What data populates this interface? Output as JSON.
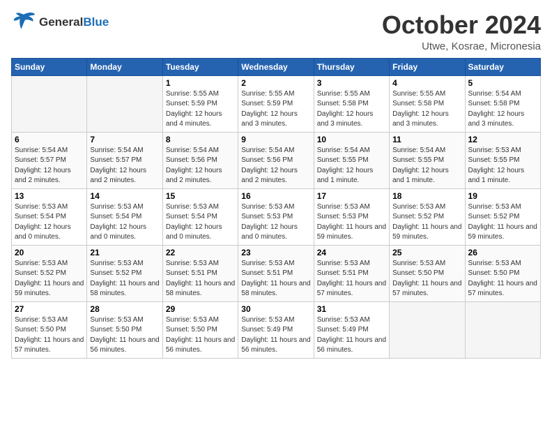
{
  "logo": {
    "line1": "General",
    "line2": "Blue"
  },
  "title": "October 2024",
  "location": "Utwe, Kosrae, Micronesia",
  "weekdays": [
    "Sunday",
    "Monday",
    "Tuesday",
    "Wednesday",
    "Thursday",
    "Friday",
    "Saturday"
  ],
  "weeks": [
    [
      {
        "day": "",
        "empty": true
      },
      {
        "day": "",
        "empty": true
      },
      {
        "day": "1",
        "sunrise": "Sunrise: 5:55 AM",
        "sunset": "Sunset: 5:59 PM",
        "daylight": "Daylight: 12 hours and 4 minutes."
      },
      {
        "day": "2",
        "sunrise": "Sunrise: 5:55 AM",
        "sunset": "Sunset: 5:59 PM",
        "daylight": "Daylight: 12 hours and 3 minutes."
      },
      {
        "day": "3",
        "sunrise": "Sunrise: 5:55 AM",
        "sunset": "Sunset: 5:58 PM",
        "daylight": "Daylight: 12 hours and 3 minutes."
      },
      {
        "day": "4",
        "sunrise": "Sunrise: 5:55 AM",
        "sunset": "Sunset: 5:58 PM",
        "daylight": "Daylight: 12 hours and 3 minutes."
      },
      {
        "day": "5",
        "sunrise": "Sunrise: 5:54 AM",
        "sunset": "Sunset: 5:58 PM",
        "daylight": "Daylight: 12 hours and 3 minutes."
      }
    ],
    [
      {
        "day": "6",
        "sunrise": "Sunrise: 5:54 AM",
        "sunset": "Sunset: 5:57 PM",
        "daylight": "Daylight: 12 hours and 2 minutes."
      },
      {
        "day": "7",
        "sunrise": "Sunrise: 5:54 AM",
        "sunset": "Sunset: 5:57 PM",
        "daylight": "Daylight: 12 hours and 2 minutes."
      },
      {
        "day": "8",
        "sunrise": "Sunrise: 5:54 AM",
        "sunset": "Sunset: 5:56 PM",
        "daylight": "Daylight: 12 hours and 2 minutes."
      },
      {
        "day": "9",
        "sunrise": "Sunrise: 5:54 AM",
        "sunset": "Sunset: 5:56 PM",
        "daylight": "Daylight: 12 hours and 2 minutes."
      },
      {
        "day": "10",
        "sunrise": "Sunrise: 5:54 AM",
        "sunset": "Sunset: 5:55 PM",
        "daylight": "Daylight: 12 hours and 1 minute."
      },
      {
        "day": "11",
        "sunrise": "Sunrise: 5:54 AM",
        "sunset": "Sunset: 5:55 PM",
        "daylight": "Daylight: 12 hours and 1 minute."
      },
      {
        "day": "12",
        "sunrise": "Sunrise: 5:53 AM",
        "sunset": "Sunset: 5:55 PM",
        "daylight": "Daylight: 12 hours and 1 minute."
      }
    ],
    [
      {
        "day": "13",
        "sunrise": "Sunrise: 5:53 AM",
        "sunset": "Sunset: 5:54 PM",
        "daylight": "Daylight: 12 hours and 0 minutes."
      },
      {
        "day": "14",
        "sunrise": "Sunrise: 5:53 AM",
        "sunset": "Sunset: 5:54 PM",
        "daylight": "Daylight: 12 hours and 0 minutes."
      },
      {
        "day": "15",
        "sunrise": "Sunrise: 5:53 AM",
        "sunset": "Sunset: 5:54 PM",
        "daylight": "Daylight: 12 hours and 0 minutes."
      },
      {
        "day": "16",
        "sunrise": "Sunrise: 5:53 AM",
        "sunset": "Sunset: 5:53 PM",
        "daylight": "Daylight: 12 hours and 0 minutes."
      },
      {
        "day": "17",
        "sunrise": "Sunrise: 5:53 AM",
        "sunset": "Sunset: 5:53 PM",
        "daylight": "Daylight: 11 hours and 59 minutes."
      },
      {
        "day": "18",
        "sunrise": "Sunrise: 5:53 AM",
        "sunset": "Sunset: 5:52 PM",
        "daylight": "Daylight: 11 hours and 59 minutes."
      },
      {
        "day": "19",
        "sunrise": "Sunrise: 5:53 AM",
        "sunset": "Sunset: 5:52 PM",
        "daylight": "Daylight: 11 hours and 59 minutes."
      }
    ],
    [
      {
        "day": "20",
        "sunrise": "Sunrise: 5:53 AM",
        "sunset": "Sunset: 5:52 PM",
        "daylight": "Daylight: 11 hours and 59 minutes."
      },
      {
        "day": "21",
        "sunrise": "Sunrise: 5:53 AM",
        "sunset": "Sunset: 5:52 PM",
        "daylight": "Daylight: 11 hours and 58 minutes."
      },
      {
        "day": "22",
        "sunrise": "Sunrise: 5:53 AM",
        "sunset": "Sunset: 5:51 PM",
        "daylight": "Daylight: 11 hours and 58 minutes."
      },
      {
        "day": "23",
        "sunrise": "Sunrise: 5:53 AM",
        "sunset": "Sunset: 5:51 PM",
        "daylight": "Daylight: 11 hours and 58 minutes."
      },
      {
        "day": "24",
        "sunrise": "Sunrise: 5:53 AM",
        "sunset": "Sunset: 5:51 PM",
        "daylight": "Daylight: 11 hours and 57 minutes."
      },
      {
        "day": "25",
        "sunrise": "Sunrise: 5:53 AM",
        "sunset": "Sunset: 5:50 PM",
        "daylight": "Daylight: 11 hours and 57 minutes."
      },
      {
        "day": "26",
        "sunrise": "Sunrise: 5:53 AM",
        "sunset": "Sunset: 5:50 PM",
        "daylight": "Daylight: 11 hours and 57 minutes."
      }
    ],
    [
      {
        "day": "27",
        "sunrise": "Sunrise: 5:53 AM",
        "sunset": "Sunset: 5:50 PM",
        "daylight": "Daylight: 11 hours and 57 minutes."
      },
      {
        "day": "28",
        "sunrise": "Sunrise: 5:53 AM",
        "sunset": "Sunset: 5:50 PM",
        "daylight": "Daylight: 11 hours and 56 minutes."
      },
      {
        "day": "29",
        "sunrise": "Sunrise: 5:53 AM",
        "sunset": "Sunset: 5:50 PM",
        "daylight": "Daylight: 11 hours and 56 minutes."
      },
      {
        "day": "30",
        "sunrise": "Sunrise: 5:53 AM",
        "sunset": "Sunset: 5:49 PM",
        "daylight": "Daylight: 11 hours and 56 minutes."
      },
      {
        "day": "31",
        "sunrise": "Sunrise: 5:53 AM",
        "sunset": "Sunset: 5:49 PM",
        "daylight": "Daylight: 11 hours and 56 minutes."
      },
      {
        "day": "",
        "empty": true
      },
      {
        "day": "",
        "empty": true
      }
    ]
  ]
}
